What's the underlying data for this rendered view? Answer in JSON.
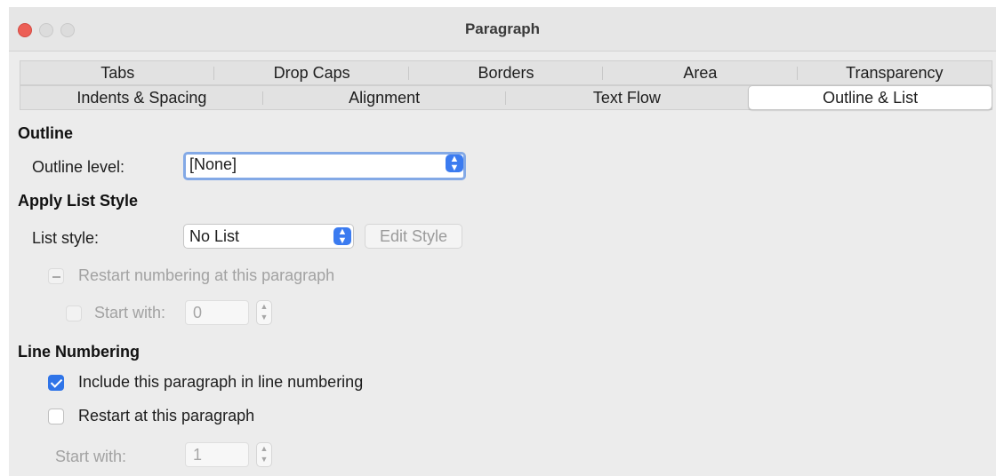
{
  "window": {
    "title": "Paragraph"
  },
  "tabs_row1": [
    "Tabs",
    "Drop Caps",
    "Borders",
    "Area",
    "Transparency"
  ],
  "tabs_row2": [
    "Indents & Spacing",
    "Alignment",
    "Text Flow",
    "Outline & List"
  ],
  "active_tab": "Outline & List",
  "outline": {
    "heading": "Outline",
    "level_label": "Outline level:",
    "level_value": "[None]"
  },
  "list_style": {
    "heading": "Apply List Style",
    "label": "List style:",
    "value": "No List",
    "edit_button": "Edit Style",
    "restart_label": "Restart numbering at this paragraph",
    "start_with_label": "Start with:",
    "start_with_value": "0"
  },
  "line_numbering": {
    "heading": "Line Numbering",
    "include_label": "Include this paragraph in line numbering",
    "include_checked": true,
    "restart_label": "Restart at this paragraph",
    "restart_checked": false,
    "start_with_label": "Start with:",
    "start_with_value": "1"
  },
  "colors": {
    "accent": "#2f74e8",
    "close": "#ec5f56"
  }
}
